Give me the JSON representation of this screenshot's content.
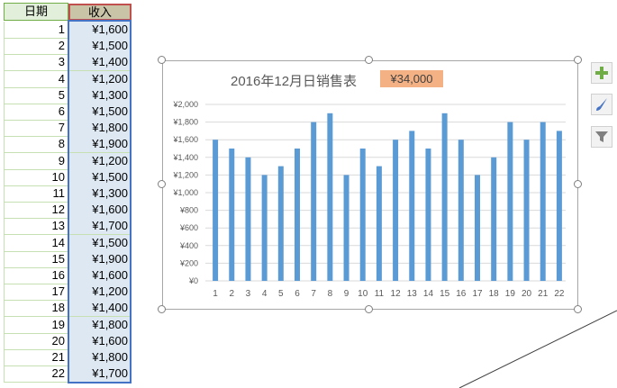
{
  "sheet": {
    "header_day": "日期",
    "header_income": "收入",
    "rows": [
      {
        "day": "1",
        "income": "¥1,600"
      },
      {
        "day": "2",
        "income": "¥1,500"
      },
      {
        "day": "3",
        "income": "¥1,400"
      },
      {
        "day": "4",
        "income": "¥1,200"
      },
      {
        "day": "5",
        "income": "¥1,300"
      },
      {
        "day": "6",
        "income": "¥1,500"
      },
      {
        "day": "7",
        "income": "¥1,800"
      },
      {
        "day": "8",
        "income": "¥1,900"
      },
      {
        "day": "9",
        "income": "¥1,200"
      },
      {
        "day": "10",
        "income": "¥1,500"
      },
      {
        "day": "11",
        "income": "¥1,300"
      },
      {
        "day": "12",
        "income": "¥1,600"
      },
      {
        "day": "13",
        "income": "¥1,700"
      },
      {
        "day": "14",
        "income": "¥1,500"
      },
      {
        "day": "15",
        "income": "¥1,900"
      },
      {
        "day": "16",
        "income": "¥1,600"
      },
      {
        "day": "17",
        "income": "¥1,200"
      },
      {
        "day": "18",
        "income": "¥1,400"
      },
      {
        "day": "19",
        "income": "¥1,800"
      },
      {
        "day": "20",
        "income": "¥1,600"
      },
      {
        "day": "21",
        "income": "¥1,800"
      },
      {
        "day": "22",
        "income": "¥1,700"
      }
    ]
  },
  "chart": {
    "title": "2016年12月日销售表",
    "total": "¥34,000",
    "bar_color": "#5b9bd5",
    "total_badge_color": "#f4b183"
  },
  "side_buttons": [
    {
      "icon": "plus-icon"
    },
    {
      "icon": "brush-icon"
    },
    {
      "icon": "filter-icon"
    }
  ],
  "chart_data": {
    "type": "bar",
    "title": "2016年12月日销售表",
    "categories": [
      "1",
      "2",
      "3",
      "4",
      "5",
      "6",
      "7",
      "8",
      "9",
      "10",
      "11",
      "12",
      "13",
      "14",
      "15",
      "16",
      "17",
      "18",
      "19",
      "20",
      "21",
      "22"
    ],
    "values": [
      1600,
      1500,
      1400,
      1200,
      1300,
      1500,
      1800,
      1900,
      1200,
      1500,
      1300,
      1600,
      1700,
      1500,
      1900,
      1600,
      1200,
      1400,
      1800,
      1600,
      1800,
      1700
    ],
    "yticks": [
      "¥0",
      "¥200",
      "¥400",
      "¥600",
      "¥800",
      "¥1,000",
      "¥1,200",
      "¥1,400",
      "¥1,600",
      "¥1,800",
      "¥2,000"
    ],
    "ylim": [
      0,
      2000
    ],
    "grid": true,
    "xlabel": "",
    "ylabel": ""
  }
}
